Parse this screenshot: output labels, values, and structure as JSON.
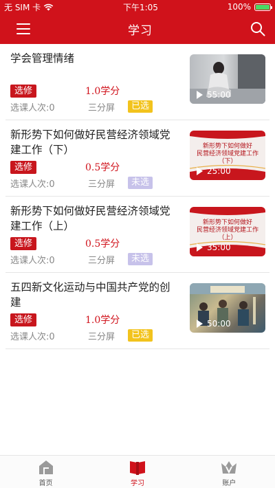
{
  "status_bar": {
    "carrier": "无 SIM 卡",
    "time": "下午1:05",
    "battery": "100%",
    "battery_level": 1.0
  },
  "nav": {
    "title": "学习",
    "menu_icon": "menu-icon",
    "search_icon": "search-icon"
  },
  "courses": [
    {
      "title": "学会管理情绪",
      "type": "选修",
      "credit": "1.0学分",
      "enroll": "选课人次:0",
      "screen": "三分屏",
      "status": "已选",
      "duration": "55:00"
    },
    {
      "title": "新形势下如何做好民营经济领域党建工作（下）",
      "type": "选修",
      "credit": "0.5学分",
      "enroll": "选课人次:0",
      "screen": "三分屏",
      "status": "未选",
      "duration": "25:00",
      "thumb_line1": "新形势下如何做好",
      "thumb_line2": "民营经济领域党建工作",
      "thumb_line3": "（下）"
    },
    {
      "title": "新形势下如何做好民营经济领域党建工作（上）",
      "type": "选修",
      "credit": "0.5学分",
      "enroll": "选课人次:0",
      "screen": "三分屏",
      "status": "未选",
      "duration": "35:00",
      "thumb_line1": "新形势下如何做好",
      "thumb_line2": "民营经济领域党建工作",
      "thumb_line3": "（上）"
    },
    {
      "title": "五四新文化运动与中国共产党的创建",
      "type": "选修",
      "credit": "1.0学分",
      "enroll": "选课人次:0",
      "screen": "三分屏",
      "status": "已选",
      "duration": "50:00"
    }
  ],
  "tabbar": {
    "home": "首页",
    "study": "学习",
    "account": "账户"
  },
  "colors": {
    "brand": "#d0121b",
    "selected": "#f2c31d",
    "unselected": "#c7c2ea"
  }
}
